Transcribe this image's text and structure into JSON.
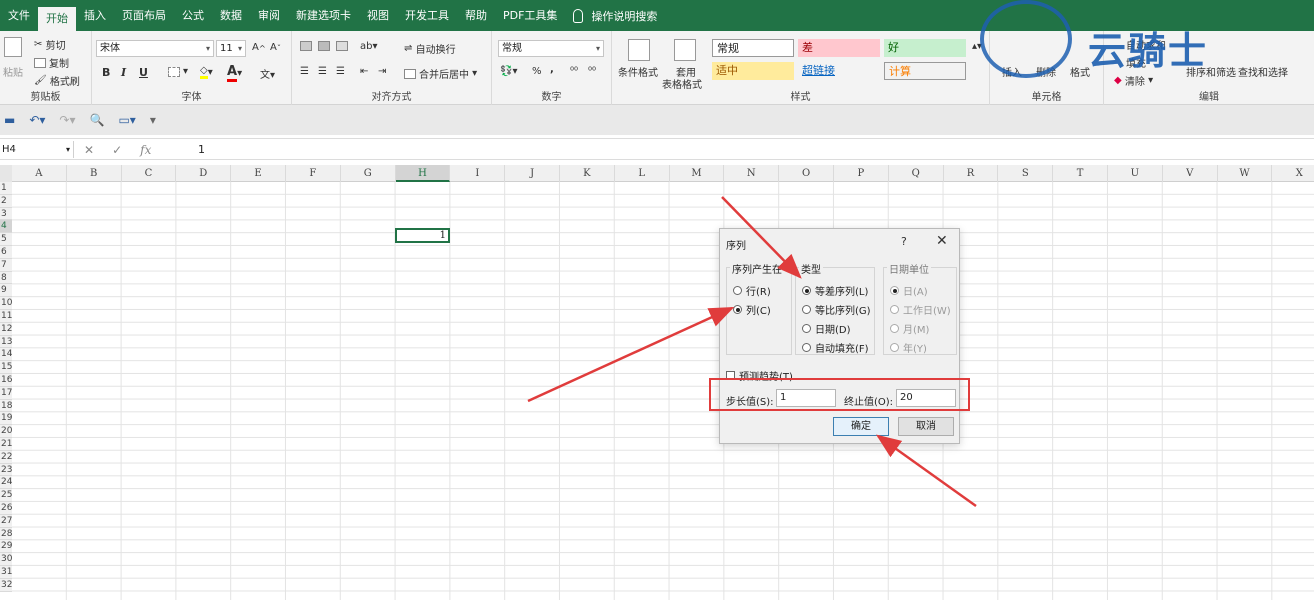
{
  "menu": {
    "tabs": [
      "文件",
      "开始",
      "插入",
      "页面布局",
      "公式",
      "数据",
      "审阅",
      "新建选项卡",
      "视图",
      "开发工具",
      "帮助",
      "PDF工具集"
    ],
    "active_tab": "开始",
    "search": "操作说明搜索"
  },
  "ribbon": {
    "clipboard": {
      "paste": "粘贴",
      "cut": "剪切",
      "copy": "复制",
      "format_painter": "格式刷",
      "label": "剪贴板"
    },
    "font": {
      "name": "宋体",
      "size": "11",
      "label": "字体",
      "bold": "B",
      "italic": "I",
      "underline": "U"
    },
    "alignment": {
      "wrap": "自动换行",
      "merge": "合并后居中",
      "label": "对齐方式"
    },
    "number": {
      "format": "常规",
      "percent": "%",
      "comma": ",",
      "label": "数字"
    },
    "styles": {
      "conditional": "条件格式",
      "table_format_1": "套用",
      "table_format_2": "表格格式",
      "cells": [
        {
          "text": "常规",
          "bg": "#ffffff",
          "fg": "#222222"
        },
        {
          "text": "差",
          "bg": "#ffc7ce",
          "fg": "#9c0006"
        },
        {
          "text": "好",
          "bg": "#c6efce",
          "fg": "#006100"
        },
        {
          "text": "适中",
          "bg": "#ffeb9c",
          "fg": "#9c5700"
        },
        {
          "text": "超链接",
          "bg": "#f3f3f3",
          "fg": "#0563c1"
        },
        {
          "text": "计算",
          "bg": "#f2f2f2",
          "fg": "#fa7d00"
        }
      ],
      "label": "样式"
    },
    "cells_group": {
      "insert": "插入",
      "delete": "删除",
      "format": "格式",
      "label": "单元格"
    },
    "editing": {
      "autosum": "自动求和",
      "fill": "填充",
      "clear": "清除",
      "sort": "排序和筛选",
      "find": "查找和选择",
      "label": "编辑"
    }
  },
  "formula_bar": {
    "name_box": "H4",
    "value": "1",
    "fx": "fx"
  },
  "sheet": {
    "columns": [
      "A",
      "B",
      "C",
      "D",
      "E",
      "F",
      "G",
      "H",
      "I",
      "J",
      "K",
      "L",
      "M",
      "N",
      "O",
      "P",
      "Q",
      "R",
      "S",
      "T",
      "U",
      "V",
      "W",
      "X"
    ],
    "selected_column": "H",
    "rows": [
      "1",
      "2",
      "3",
      "4",
      "5",
      "6",
      "7",
      "8",
      "9",
      "10",
      "11",
      "12",
      "13",
      "14",
      "15",
      "16",
      "17",
      "18",
      "19",
      "20",
      "21",
      "22",
      "23",
      "24",
      "25",
      "26",
      "27",
      "28",
      "29",
      "30",
      "31",
      "32"
    ],
    "active_cell_value": "1"
  },
  "dialog": {
    "title": "序列",
    "help": "?",
    "close": "✕",
    "series_in": {
      "legend": "序列产生在",
      "options": [
        "行(R)",
        "列(C)"
      ],
      "selected": 1
    },
    "type": {
      "legend": "类型",
      "options": [
        "等差序列(L)",
        "等比序列(G)",
        "日期(D)",
        "自动填充(F)"
      ],
      "selected": 0
    },
    "date_unit": {
      "legend": "日期单位",
      "options": [
        "日(A)",
        "工作日(W)",
        "月(M)",
        "年(Y)"
      ],
      "selected": 0
    },
    "trend": "预测趋势(T)",
    "step_label": "步长值(S):",
    "step_value": "1",
    "stop_label": "终止值(O):",
    "stop_value": "20",
    "ok": "确定",
    "cancel": "取消"
  },
  "watermark": {
    "text": "云骑士"
  },
  "colors": {
    "excel_green": "#217346",
    "annotation_red": "#e03c3c"
  }
}
